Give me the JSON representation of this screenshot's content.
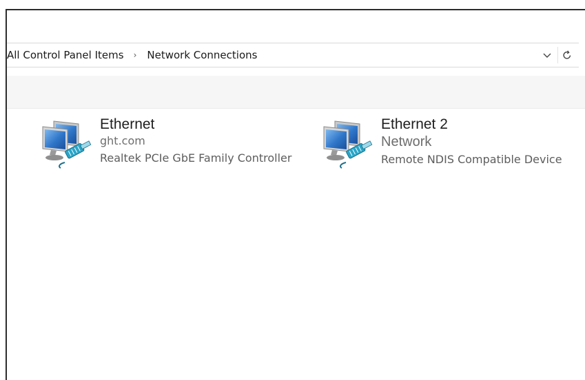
{
  "address_bar": {
    "breadcrumbs": [
      "All Control Panel Items",
      "Network Connections"
    ],
    "separator": "›",
    "dropdown_icon": "chevron-down-icon",
    "refresh_icon": "refresh-icon"
  },
  "connections": [
    {
      "name": "Ethernet",
      "status": "ght.com",
      "device": "Realtek PCIe GbE Family Controller",
      "icon": "network-connection-icon"
    },
    {
      "name": "Ethernet 2",
      "status": "Network",
      "device": "Remote NDIS Compatible Device",
      "icon": "network-connection-icon"
    }
  ],
  "colors": {
    "window_border": "#2b2b2b",
    "toolbar_bg": "#f6f6f6",
    "text_primary": "#1e1e1e",
    "text_secondary": "#6d6d6d",
    "monitor_blue": "#2f76c9",
    "cable_teal": "#2aa6c8"
  }
}
